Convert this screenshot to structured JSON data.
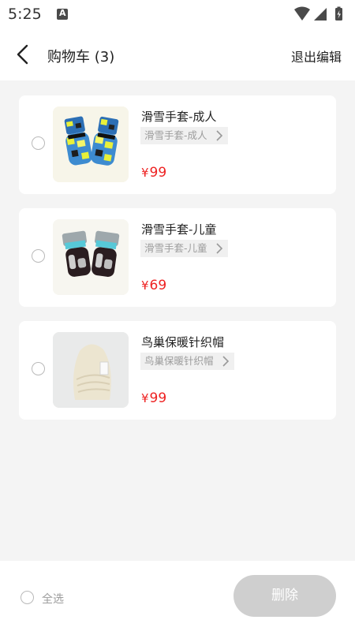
{
  "status_bar": {
    "time": "5:25"
  },
  "header": {
    "title": "购物车 (3)",
    "exit_edit": "退出编辑"
  },
  "items": [
    {
      "name": "滑雪手套-成人",
      "variant": "滑雪手套-成人",
      "currency": "¥",
      "price": "99"
    },
    {
      "name": "滑雪手套-儿童",
      "variant": "滑雪手套-儿童",
      "currency": "¥",
      "price": "69"
    },
    {
      "name": "鸟巢保暖针织帽",
      "variant": "鸟巢保暖针织帽",
      "currency": "¥",
      "price": "99"
    }
  ],
  "footer": {
    "select_all": "全选",
    "delete": "删除"
  },
  "colors": {
    "price": "#ee2222",
    "delete_button_disabled": "#cfcfcf",
    "background": "#f4f4f4"
  }
}
